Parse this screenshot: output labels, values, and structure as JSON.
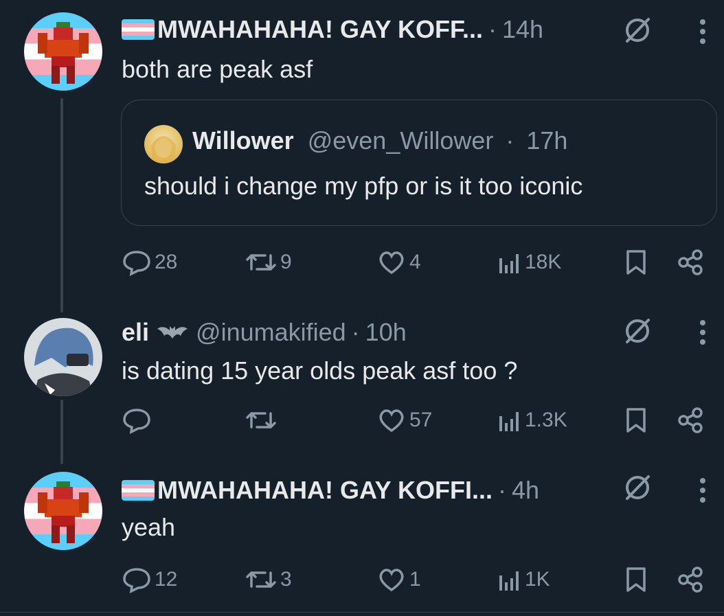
{
  "posts": [
    {
      "name": "MWAHAHAHA! GAY KOFF...",
      "handle": "",
      "time": "14h",
      "text": "both are peak asf",
      "quote": {
        "name": "Willower",
        "handle": "@even_Willower",
        "time": "17h",
        "text": "should i change my pfp or is it too iconic"
      },
      "stats": {
        "replies": "28",
        "reposts": "9",
        "likes": "4",
        "views": "18K"
      }
    },
    {
      "name": "eli",
      "handle": "@inumakified",
      "time": "10h",
      "text": "is dating 15 year olds peak asf too ?",
      "stats": {
        "replies": "",
        "reposts": "",
        "likes": "57",
        "views": "1.3K"
      }
    },
    {
      "name": "MWAHAHAHA! GAY KOFFI...",
      "handle": "",
      "time": "4h",
      "text": "yeah",
      "stats": {
        "replies": "12",
        "reposts": "3",
        "likes": "1",
        "views": "1K"
      }
    }
  ],
  "separator": "·",
  "icons": {
    "reply": "reply-icon",
    "repost": "repost-icon",
    "like": "heart-icon",
    "views": "views-icon",
    "bookmark": "bookmark-icon",
    "share": "share-icon",
    "grok": "grok-icon",
    "more": "more-icon",
    "flag": "trans-flag-icon",
    "bat": "bat-icon"
  },
  "colors": {
    "background": "#15202b",
    "text": "#e7e9ea",
    "muted": "#8b98a5",
    "border": "#38444d",
    "trans_blue": "#5bcefa",
    "trans_pink": "#f5a9b8"
  }
}
